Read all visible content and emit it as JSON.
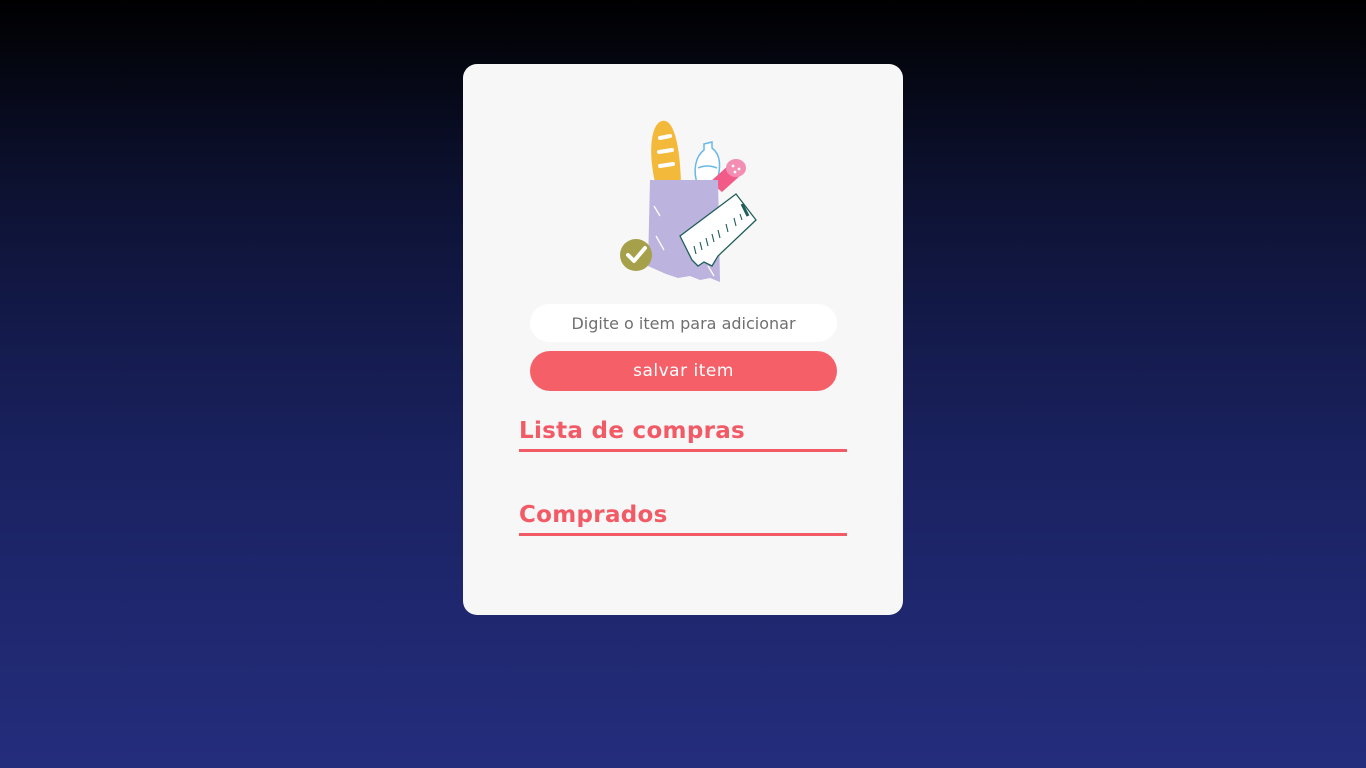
{
  "card": {
    "illustration_icon": "shopping-bag-groceries-icon"
  },
  "form": {
    "input_placeholder": "Digite o item para adicionar",
    "input_value": "",
    "save_label": "salvar item"
  },
  "sections": {
    "shopping_list_title": "Lista de compras",
    "bought_title": "Comprados"
  },
  "colors": {
    "accent": "#f55f68",
    "card_background": "#f7f7f7",
    "background_top": "#000000",
    "background_bottom": "#242d7c"
  }
}
